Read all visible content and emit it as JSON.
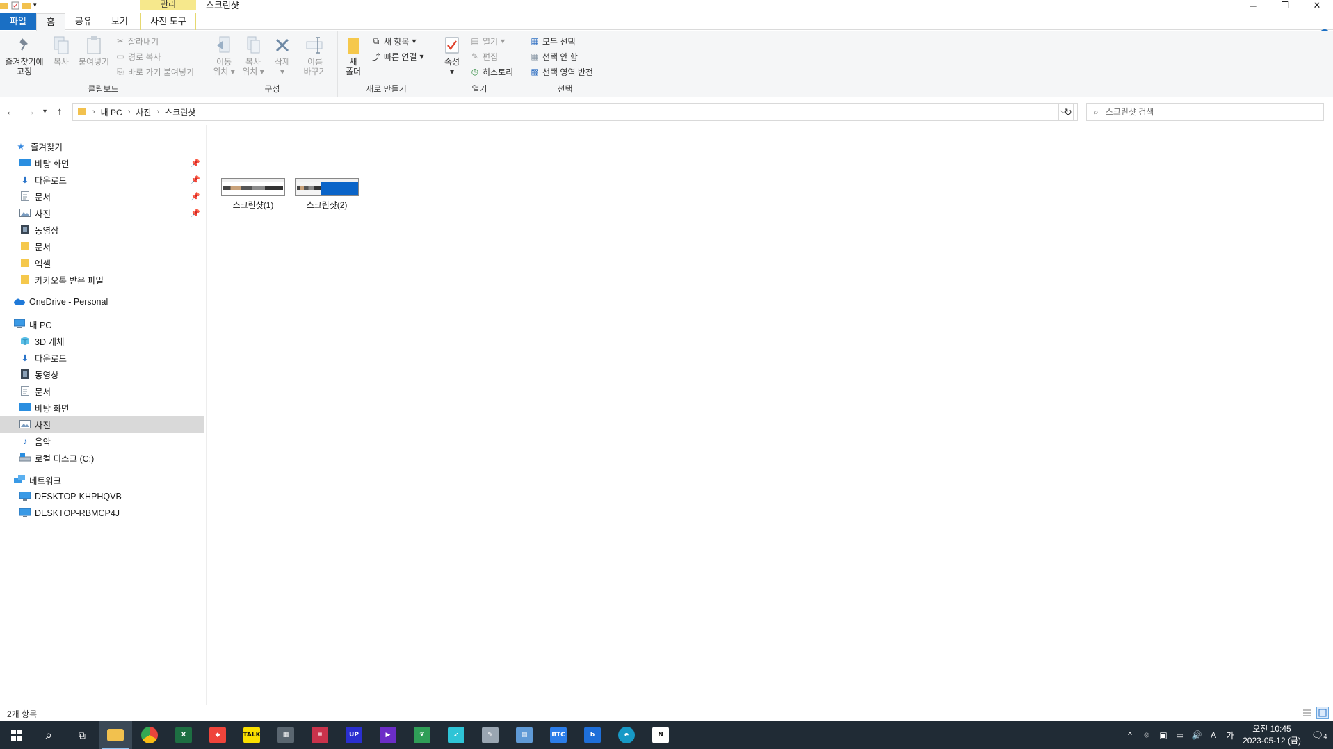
{
  "titlebar": {
    "context_tab": "관리",
    "title": "스크린샷",
    "controls": [
      "─",
      "❐",
      "✕"
    ]
  },
  "tabs": {
    "file": "파일",
    "home": "홈",
    "share": "공유",
    "view": "보기",
    "photo_tools": "사진 도구"
  },
  "ribbon": {
    "clipboard": {
      "label": "클립보드",
      "pin": "즐겨찾기에",
      "pin2": "고정",
      "copy": "복사",
      "paste": "붙여넣기",
      "cut": "잘라내기",
      "copy_path": "경로 복사",
      "paste_shortcut": "바로 가기 붙여넣기"
    },
    "organize": {
      "label": "구성",
      "move_to": "이동",
      "move_to2": "위치",
      "copy_to": "복사",
      "copy_to2": "위치",
      "delete": "삭제",
      "rename": "이름",
      "rename2": "바꾸기"
    },
    "new": {
      "label": "새로 만들기",
      "new_folder": "새",
      "new_folder2": "폴더",
      "new_item": "새 항목",
      "easy_access": "빠른 연결"
    },
    "open": {
      "label": "열기",
      "properties": "속성",
      "open": "열기",
      "edit": "편집",
      "history": "히스토리"
    },
    "select": {
      "label": "선택",
      "select_all": "모두 선택",
      "select_none": "선택 안 함",
      "invert": "선택 영역 반전"
    }
  },
  "address": {
    "crumbs": [
      "내 PC",
      "사진",
      "스크린샷"
    ],
    "search_placeholder": "스크린샷 검색"
  },
  "nav": {
    "quick_access": "즐겨찾기",
    "quick_items": [
      "바탕 화면",
      "다운로드",
      "문서",
      "사진",
      "동영상",
      "문서",
      "엑셀",
      "카카오톡 받은 파일"
    ],
    "onedrive": "OneDrive - Personal",
    "this_pc": "내 PC",
    "pc_items": [
      "3D 개체",
      "다운로드",
      "동영상",
      "문서",
      "바탕 화면",
      "사진",
      "음악",
      "로컬 디스크 (C:)"
    ],
    "network": "네트워크",
    "network_items": [
      "DESKTOP-KHPHQVB",
      "DESKTOP-RBMCP4J"
    ]
  },
  "files": [
    {
      "name": "스크린샷(1)"
    },
    {
      "name": "스크린샷(2)"
    }
  ],
  "status": {
    "count": "2개 항목"
  },
  "taskbar": {
    "apps": [
      {
        "name": "file-explorer",
        "color": "#f2c14e",
        "label": ""
      },
      {
        "name": "chrome",
        "color": "#e8453c",
        "label": ""
      },
      {
        "name": "excel",
        "color": "#1d6f42",
        "label": "X"
      },
      {
        "name": "anydesk",
        "color": "#ef443b",
        "label": "◆"
      },
      {
        "name": "kakaotalk",
        "color": "#f9e000",
        "label": "TALK"
      },
      {
        "name": "calculator",
        "color": "#5a6670",
        "label": "▦"
      },
      {
        "name": "app-red",
        "color": "#c8324b",
        "label": "≡"
      },
      {
        "name": "upzero",
        "color": "#2a2fd0",
        "label": "UP"
      },
      {
        "name": "visual-studio",
        "color": "#6c2dc7",
        "label": "▶"
      },
      {
        "name": "leaf-app",
        "color": "#2f9e57",
        "label": "❦"
      },
      {
        "name": "bird-app",
        "color": "#2ec4d6",
        "label": "➶"
      },
      {
        "name": "paint-app",
        "color": "#9aa6b2",
        "label": "✎"
      },
      {
        "name": "notepad-app",
        "color": "#5f9ad6",
        "label": "▤"
      },
      {
        "name": "btc-app",
        "color": "#2b7de9",
        "label": "BTC"
      },
      {
        "name": "bing-app",
        "color": "#1e6fd9",
        "label": "b"
      },
      {
        "name": "edge",
        "color": "#1799c6",
        "label": "e"
      },
      {
        "name": "notion",
        "color": "#ffffff",
        "label": "N"
      }
    ],
    "tray_icons": [
      "^",
      "⌾",
      "▣",
      "▭",
      "🔊",
      "A",
      "가"
    ],
    "time": "오전 10:45",
    "date": "2023-05-12 (금)",
    "notifications": "4"
  }
}
